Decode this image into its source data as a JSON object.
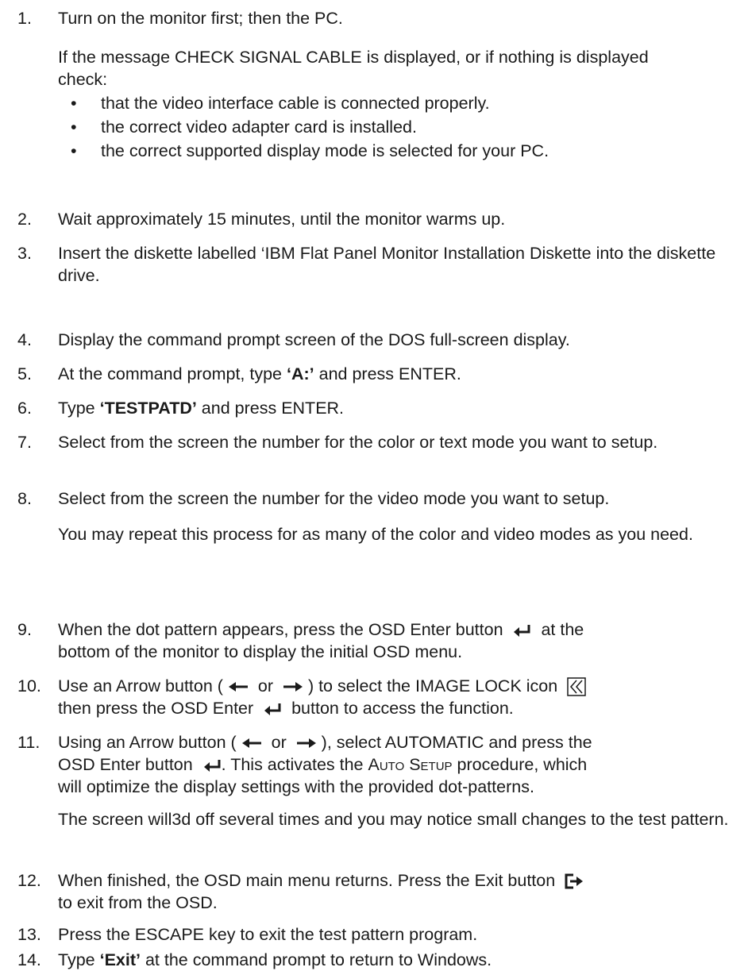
{
  "steps": [
    {
      "number": "1.",
      "text": "Turn on the monitor first; then the PC.",
      "note": "If the message CHECK SIGNAL CABLE is displayed, or if nothing is displayed check:",
      "bullets": [
        "that the video interface cable is connected properly.",
        "the correct video adapter card is installed.",
        "the correct supported display mode is selected for your PC."
      ]
    },
    {
      "number": "2.",
      "text": "Wait approximately 15 minutes, until the monitor warms up."
    },
    {
      "number": "3.",
      "text": "Insert the diskette labelled ‘IBM Flat Panel Monitor Installation Diskette into the diskette drive."
    },
    {
      "number": "4.",
      "text": "Display the command prompt screen of the DOS full-screen display."
    },
    {
      "number": "5.",
      "pre": "At the command prompt, type ",
      "bold": "‘A:’",
      "post": " and press ENTER."
    },
    {
      "number": "6.",
      "pre": "Type ",
      "bold": "‘TESTPATD’",
      "post": " and press ENTER."
    },
    {
      "number": "7.",
      "text": "Select from the screen the number for the color or text mode you want to setup."
    },
    {
      "number": "8.",
      "text": "Select from the screen the number for the video mode you want to setup.",
      "note": "You may repeat this process for as many of the color and video modes as you need."
    },
    {
      "number": "9.",
      "line1_pre": "When the dot pattern appears, press the OSD Enter button",
      "line1_post": "at the",
      "line2": "bottom of the monitor to display the initial OSD menu."
    },
    {
      "number": "10.",
      "line1_a": "Use an Arrow button (",
      "line1_or": "or",
      "line1_b": ") to select the IMAGE LOCK icon",
      "line2_a": "then press the OSD Enter",
      "line2_b": "button to access the function."
    },
    {
      "number": "11.",
      "line1_a": "Using an Arrow button (",
      "line1_or": "or",
      "line1_b": "), select AUTOMATIC and press the",
      "line2_a": "OSD Enter button",
      "line2_b": ". This activates the ",
      "line2_sc": "Auto Setup",
      "line2_c": " procedure, which",
      "line3": "will optimize the display settings with the provided dot-patterns.",
      "note": "The screen will3d off several times and you may notice small changes to the test pattern."
    },
    {
      "number": "12.",
      "line1": "When finished, the OSD main menu returns. Press the Exit button",
      "line2": "to exit from the OSD."
    },
    {
      "number": "13.",
      "text": "Press the ESCAPE key to exit the test pattern program."
    },
    {
      "number": "14.",
      "pre": "Type ",
      "bold": "‘Exit’",
      "post": " at the command prompt to return to Windows."
    }
  ],
  "icons": {
    "enter": "enter-key-icon",
    "left_arrow": "left-arrow-icon",
    "right_arrow": "right-arrow-icon",
    "image_lock": "image-lock-icon",
    "exit": "exit-icon"
  }
}
